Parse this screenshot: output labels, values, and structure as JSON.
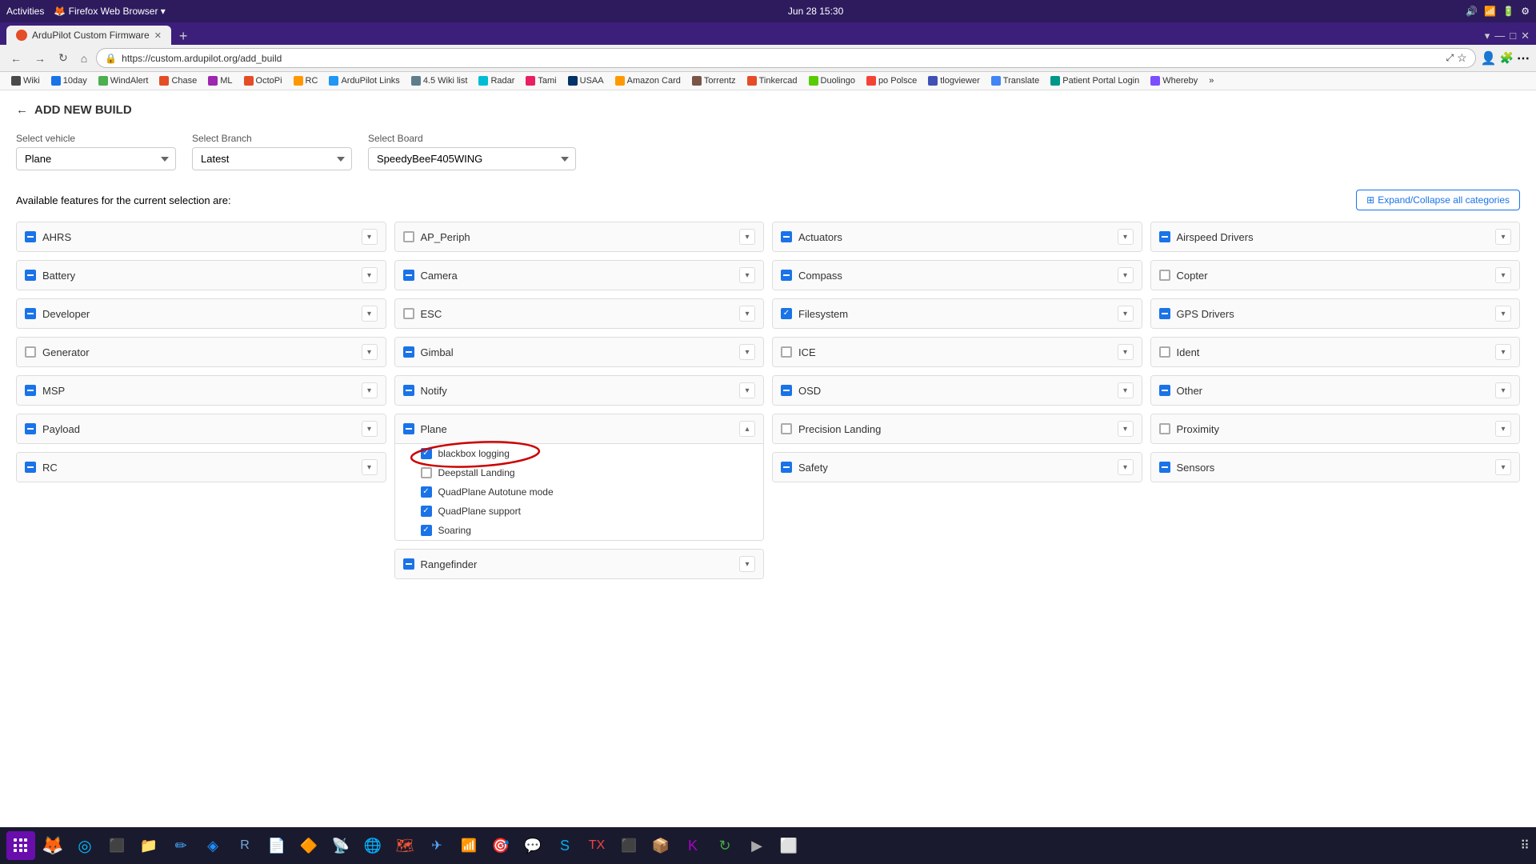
{
  "os_bar": {
    "activities": "Activities",
    "browser": "Firefox Web Browser",
    "datetime": "Jun 28  15:30",
    "dropdown_arrow": "▾"
  },
  "tab": {
    "title": "ArduPilot Custom Firmware",
    "favicon": "🔧"
  },
  "url": "https://custom.ardupilot.org/add_build",
  "bookmarks": [
    {
      "label": "Wiki",
      "class": "fav-wiki"
    },
    {
      "label": "10day",
      "class": "fav-10day"
    },
    {
      "label": "WindAlert",
      "class": "fav-wind"
    },
    {
      "label": "Chase",
      "class": "fav-chase"
    },
    {
      "label": "ML",
      "class": "fav-ml"
    },
    {
      "label": "OctoPi",
      "class": "fav-octo"
    },
    {
      "label": "RC",
      "class": "fav-rc"
    },
    {
      "label": "ArduPilot Links",
      "class": "fav-ardupilot"
    },
    {
      "label": "4.5 Wiki list",
      "class": "fav-wiki2"
    },
    {
      "label": "Radar",
      "class": "fav-radar"
    },
    {
      "label": "Tami",
      "class": "fav-tami"
    },
    {
      "label": "USAA",
      "class": "fav-usaa"
    },
    {
      "label": "Amazon Card",
      "class": "fav-amazon"
    },
    {
      "label": "Torrentz",
      "class": "fav-torrentz"
    },
    {
      "label": "Tinkercad",
      "class": "fav-tinkercad"
    },
    {
      "label": "Duolingo",
      "class": "fav-duolingo"
    },
    {
      "label": "po Polsce",
      "class": "fav-po"
    },
    {
      "label": "tlogviewer",
      "class": "fav-tlog"
    },
    {
      "label": "Translate",
      "class": "fav-translate"
    },
    {
      "label": "Patient Portal Login",
      "class": "fav-patient"
    },
    {
      "label": "Whereby",
      "class": "fav-whereby"
    }
  ],
  "page": {
    "title": "ADD NEW BUILD",
    "select_vehicle_label": "Select vehicle",
    "select_vehicle_value": "Plane",
    "select_branch_label": "Select Branch",
    "select_branch_value": "Latest",
    "select_board_label": "Select Board",
    "select_board_value": "SpeedyBeeF405WING",
    "features_header": "Available features for the current selection are:",
    "expand_btn": "Expand/Collapse all categories"
  },
  "features": {
    "col1": [
      {
        "name": "AHRS",
        "state": "indeterminate",
        "expanded": false
      },
      {
        "name": "Battery",
        "state": "indeterminate",
        "expanded": false
      },
      {
        "name": "Developer",
        "state": "indeterminate",
        "expanded": false
      },
      {
        "name": "Generator",
        "state": "unchecked",
        "expanded": false
      },
      {
        "name": "MSP",
        "state": "indeterminate",
        "expanded": false
      },
      {
        "name": "Payload",
        "state": "indeterminate",
        "expanded": false
      }
    ],
    "col2": [
      {
        "name": "AP_Periph",
        "state": "unchecked",
        "expanded": false
      },
      {
        "name": "Camera",
        "state": "indeterminate",
        "expanded": false
      },
      {
        "name": "ESC",
        "state": "unchecked",
        "expanded": false
      },
      {
        "name": "Gimbal",
        "state": "indeterminate",
        "expanded": false
      },
      {
        "name": "Notify",
        "state": "indeterminate",
        "expanded": false
      },
      {
        "name": "Plane",
        "state": "indeterminate",
        "expanded": true,
        "subitems": [
          {
            "label": "blackbox logging",
            "checked": true,
            "circled": true
          },
          {
            "label": "Deepstall Landing",
            "checked": false
          },
          {
            "label": "QuadPlane Autotune mode",
            "checked": true
          },
          {
            "label": "QuadPlane support",
            "checked": true
          },
          {
            "label": "Soaring",
            "checked": true
          }
        ]
      }
    ],
    "col3": [
      {
        "name": "Actuators",
        "state": "indeterminate",
        "expanded": false
      },
      {
        "name": "Compass",
        "state": "indeterminate",
        "expanded": false
      },
      {
        "name": "Filesystem",
        "state": "checked",
        "expanded": false
      },
      {
        "name": "ICE",
        "state": "unchecked",
        "expanded": false
      },
      {
        "name": "OSD",
        "state": "indeterminate",
        "expanded": false
      },
      {
        "name": "Precision Landing",
        "state": "unchecked",
        "expanded": false
      }
    ],
    "col4": [
      {
        "name": "Airspeed Drivers",
        "state": "indeterminate",
        "expanded": false
      },
      {
        "name": "Copter",
        "state": "unchecked",
        "expanded": false
      },
      {
        "name": "GPS Drivers",
        "state": "indeterminate",
        "expanded": false
      },
      {
        "name": "Ident",
        "state": "unchecked",
        "expanded": false
      },
      {
        "name": "Other",
        "state": "indeterminate",
        "expanded": false
      },
      {
        "name": "Proximity",
        "state": "unchecked",
        "expanded": false
      }
    ]
  },
  "bottom_row_col1": {
    "name": "RC",
    "state": "indeterminate"
  },
  "bottom_row_col2": {
    "name": "Rangefinder",
    "state": "indeterminate"
  },
  "bottom_row_col3": {
    "name": "Safety",
    "state": "indeterminate"
  },
  "bottom_row_col4": {
    "name": "Sensors",
    "state": "indeterminate"
  }
}
